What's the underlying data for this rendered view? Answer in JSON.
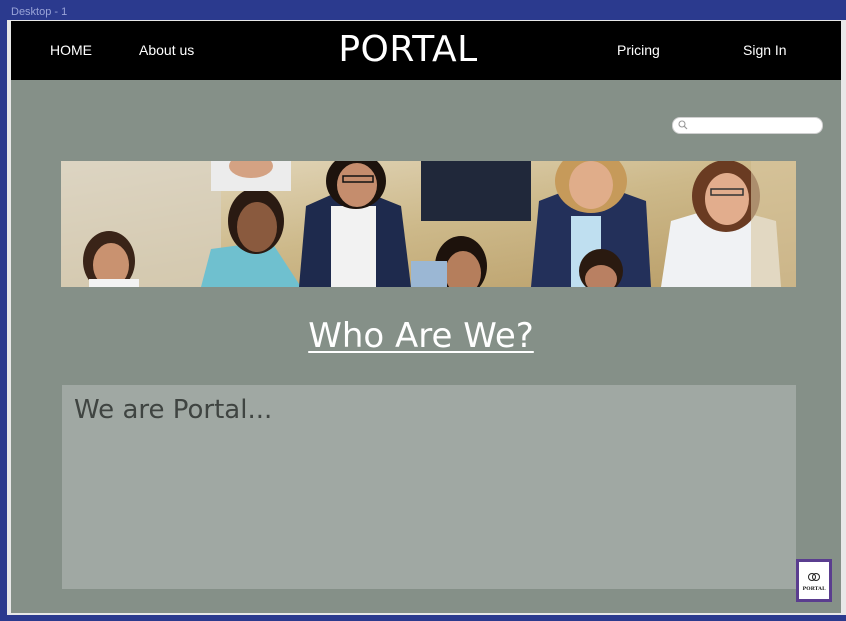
{
  "artboard": {
    "label": "Desktop - 1"
  },
  "nav": {
    "home": "HOME",
    "about": "About us",
    "brand": "PORTAL",
    "pricing": "Pricing",
    "signin": "Sign In"
  },
  "search": {
    "placeholder": ""
  },
  "banner": {
    "description": "students-group-photo"
  },
  "main": {
    "heading": "Who Are We?",
    "body": "We are Portal..."
  },
  "badge": {
    "label": "PORTAL"
  },
  "colors": {
    "page_bg": "#859088",
    "navbar": "#000000",
    "content_box": "#a0a8a3",
    "canvas": "#2b3a8e",
    "badge": "#5a3d8f"
  }
}
